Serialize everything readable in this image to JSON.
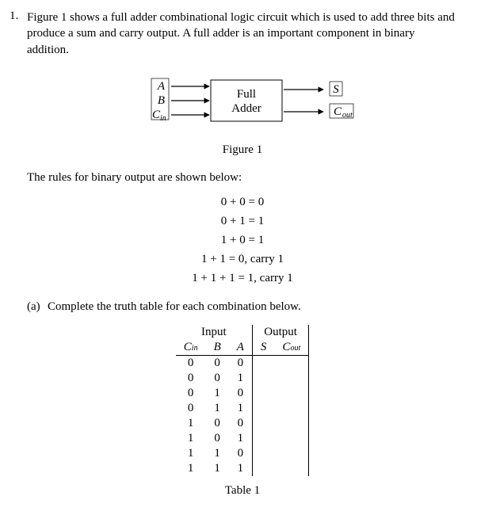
{
  "question": {
    "number": "1.",
    "intro": "Figure 1 shows a full adder combinational logic circuit which is used to add three bits and produce a sum and carry output. A full adder is an important component in binary addition."
  },
  "figure": {
    "inputs": {
      "A": "A",
      "B": "B",
      "Cin_base": "C",
      "Cin_sub": "in"
    },
    "block_label_line1": "Full",
    "block_label_line2": "Adder",
    "outputs": {
      "S": "S",
      "Cout_base": "C",
      "Cout_sub": "out"
    },
    "caption": "Figure 1"
  },
  "rules": {
    "intro": "The rules for binary output are shown below:",
    "lines": [
      "0 + 0 = 0",
      "0 + 1 = 1",
      "1 + 0 = 1",
      "1 + 1 = 0, carry 1",
      "1 + 1 + 1 = 1, carry 1"
    ]
  },
  "subpart": {
    "label": "(a)",
    "text": "Complete the truth table for each combination below."
  },
  "truth_table": {
    "group_headers": {
      "input": "Input",
      "output": "Output"
    },
    "columns": {
      "cin_base": "C",
      "cin_sub": "in",
      "b": "B",
      "a": "A",
      "s": "S",
      "cout_base": "C",
      "cout_sub": "out"
    },
    "rows": [
      {
        "cin": "0",
        "b": "0",
        "a": "0",
        "s": "",
        "cout": ""
      },
      {
        "cin": "0",
        "b": "0",
        "a": "1",
        "s": "",
        "cout": ""
      },
      {
        "cin": "0",
        "b": "1",
        "a": "0",
        "s": "",
        "cout": ""
      },
      {
        "cin": "0",
        "b": "1",
        "a": "1",
        "s": "",
        "cout": ""
      },
      {
        "cin": "1",
        "b": "0",
        "a": "0",
        "s": "",
        "cout": ""
      },
      {
        "cin": "1",
        "b": "0",
        "a": "1",
        "s": "",
        "cout": ""
      },
      {
        "cin": "1",
        "b": "1",
        "a": "0",
        "s": "",
        "cout": ""
      },
      {
        "cin": "1",
        "b": "1",
        "a": "1",
        "s": "",
        "cout": ""
      }
    ],
    "caption": "Table 1"
  }
}
